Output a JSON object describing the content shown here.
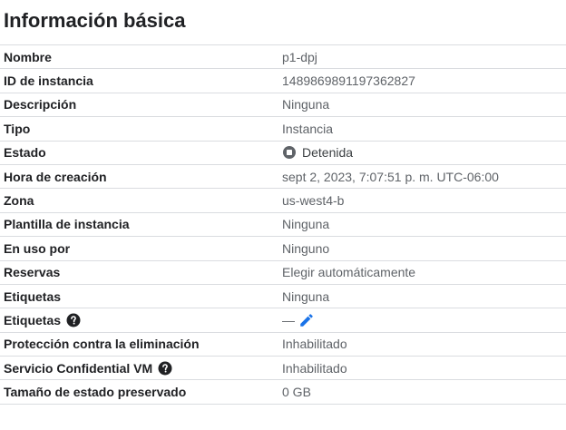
{
  "page_title": "Información básica",
  "rows": [
    {
      "label": "Nombre",
      "value": "p1-dpj"
    },
    {
      "label": "ID de instancia",
      "value": "1489869891197362827"
    },
    {
      "label": "Descripción",
      "value": "Ninguna"
    },
    {
      "label": "Tipo",
      "value": "Instancia"
    },
    {
      "label": "Estado",
      "value": "Detenida"
    },
    {
      "label": "Hora de creación",
      "value": "sept 2, 2023, 7:07:51 p. m. UTC-06:00"
    },
    {
      "label": "Zona",
      "value": "us-west4-b"
    },
    {
      "label": "Plantilla de instancia",
      "value": "Ninguna"
    },
    {
      "label": "En uso por",
      "value": "Ninguno"
    },
    {
      "label": "Reservas",
      "value": "Elegir automáticamente"
    },
    {
      "label": "Etiquetas",
      "value": "Ninguna"
    },
    {
      "label": "Etiquetas",
      "value": "—",
      "icons": [
        "help-icon",
        "edit-icon"
      ]
    },
    {
      "label": "Protección contra la eliminación",
      "value": "Inhabilitado"
    },
    {
      "label": "Servicio Confidential VM",
      "value": "Inhabilitado",
      "icons": [
        "help-icon"
      ]
    },
    {
      "label": "Tamaño de estado preservado",
      "value": "0 GB"
    }
  ],
  "status_icon": "stop-circle-icon",
  "colors": {
    "label": "#202124",
    "value": "#5f6368",
    "divider": "#dadce0",
    "edit": "#1a73e8",
    "status_icon": "#5f6368"
  }
}
